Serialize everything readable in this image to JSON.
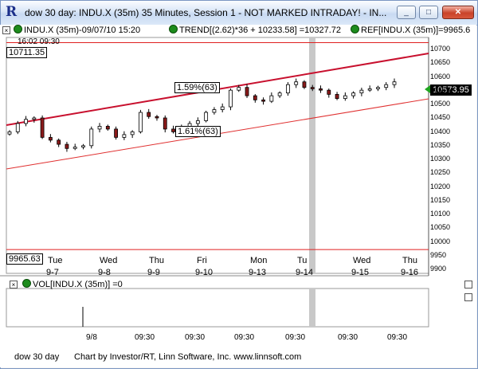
{
  "window": {
    "title": "dow 30 day: INDU.X (35m) 35 Minutes, Session 1 - NOT MARKED INTRADAY! - IN...",
    "minimize": "_",
    "maximize": "□",
    "close": "✕"
  },
  "legend": {
    "ctrl_x": "×",
    "main": "INDU.X (35m)-09/07/10 15:20",
    "trend": "TREND[(2.62)*36 + 10233.58] =10327.72",
    "ref": "REF[INDU.X (35m)]=9965.6",
    "cursor_time": "16:02  09:30"
  },
  "price_boxes": {
    "ref_high": "10711.35",
    "ref_low": "9965.63",
    "last": "10573.95",
    "channel_upper": "1.59%(63)",
    "channel_lower": "1.61%(63)"
  },
  "y_axis": {
    "ticks": [
      "10700",
      "10650",
      "10600",
      "10550",
      "10500",
      "10450",
      "10400",
      "10350",
      "10300",
      "10250",
      "10200",
      "10150",
      "10100",
      "10050",
      "10000",
      "9950",
      "9900"
    ]
  },
  "x_axis": {
    "days": [
      {
        "dow": "Tue",
        "date": "9-7"
      },
      {
        "dow": "Wed",
        "date": "9-8"
      },
      {
        "dow": "Thu",
        "date": "9-9"
      },
      {
        "dow": "Fri",
        "date": "9-10"
      },
      {
        "dow": "Mon",
        "date": "9-13"
      },
      {
        "dow": "Tu",
        "date": "9-14"
      },
      {
        "dow": "Wed",
        "date": "9-15"
      },
      {
        "dow": "Thu",
        "date": "9-16"
      }
    ],
    "bottom": [
      "9/8",
      "09:30",
      "09:30",
      "09:30",
      "09:30",
      "09:30",
      "09:30"
    ]
  },
  "volume": {
    "label": "VOL[INDU.X (35m)] =0",
    "ctrl_x": "×"
  },
  "footer": {
    "chart_name": "dow 30 day",
    "credit": "Chart by Investor/RT, Linn Software, Inc. www.linnsoft.com"
  },
  "colors": {
    "trend": "#c8102e",
    "ref": "#e02020",
    "candle_up": "#ffffff",
    "candle_down": "#8b1a1a",
    "highlight": "#c8c8c8",
    "last_marker": "#1fa51f"
  },
  "chart_data": {
    "type": "candlestick",
    "ylim": [
      9880,
      10730
    ],
    "approx_closes": [
      10390,
      10420,
      10435,
      10440,
      10370,
      10360,
      10345,
      10330,
      10335,
      10340,
      10400,
      10410,
      10400,
      10370,
      10380,
      10390,
      10460,
      10445,
      10440,
      10400,
      10390,
      10410,
      10420,
      10430,
      10460,
      10470,
      10480,
      10540,
      10550,
      10520,
      10505,
      10500,
      10520,
      10530,
      10560,
      10570,
      10550,
      10545,
      10540,
      10525,
      10510,
      10520,
      10530,
      10540,
      10545,
      10550,
      10560,
      10570
    ],
    "ref_high": 10711.35,
    "ref_low": 9965.63,
    "last": 10573.95
  }
}
